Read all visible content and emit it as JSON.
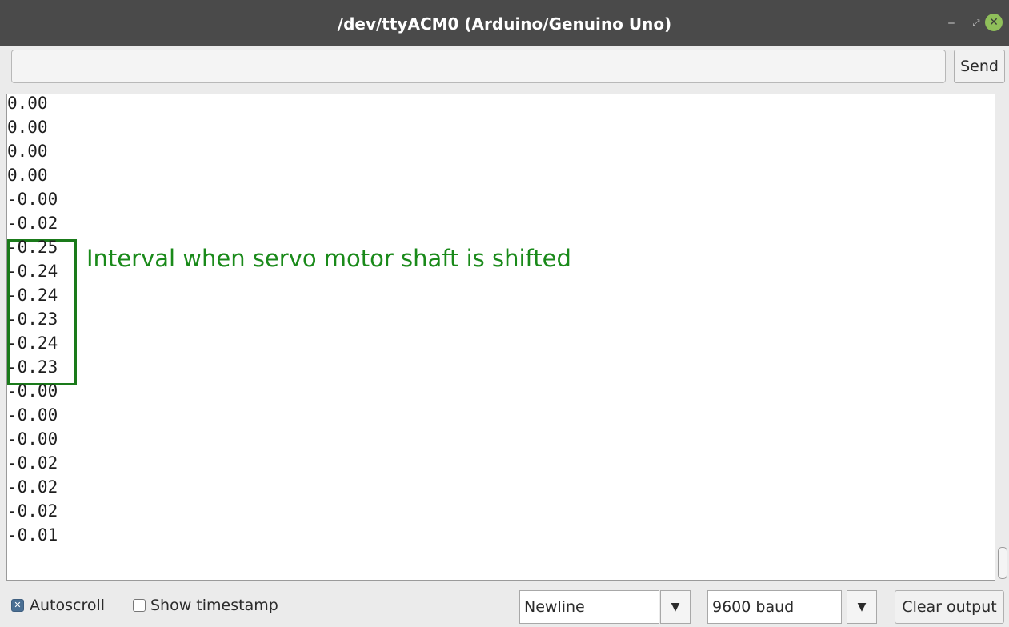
{
  "window": {
    "title": "/dev/ttyACM0 (Arduino/Genuino Uno)",
    "minimize_glyph": "‒",
    "maximize_glyph": "⤢",
    "close_glyph": "✕"
  },
  "input_row": {
    "message_value": "",
    "send_label": "Send"
  },
  "output": {
    "lines": [
      "0.00",
      "0.00",
      "0.00",
      "0.00",
      "-0.00",
      "-0.02",
      "-0.25",
      "-0.24",
      "-0.24",
      "-0.23",
      "-0.24",
      "-0.23",
      "-0.00",
      "-0.00",
      "-0.00",
      "-0.02",
      "-0.02",
      "-0.02",
      "-0.01"
    ],
    "annotation": "Interval when servo motor shaft is shifted",
    "annotation_color": "#1a8a1a"
  },
  "bottom_bar": {
    "autoscroll": {
      "label": "Autoscroll",
      "checked": true
    },
    "timestamp": {
      "label": "Show timestamp",
      "checked": false
    },
    "line_ending": "Newline",
    "baud_rate": "9600 baud",
    "dropdown_glyph": "▼",
    "clear_label": "Clear output"
  },
  "colors": {
    "titlebar": "#4a4a4a",
    "close_button": "#8fbf5a",
    "checkbox_checked": "#4a6f93"
  }
}
